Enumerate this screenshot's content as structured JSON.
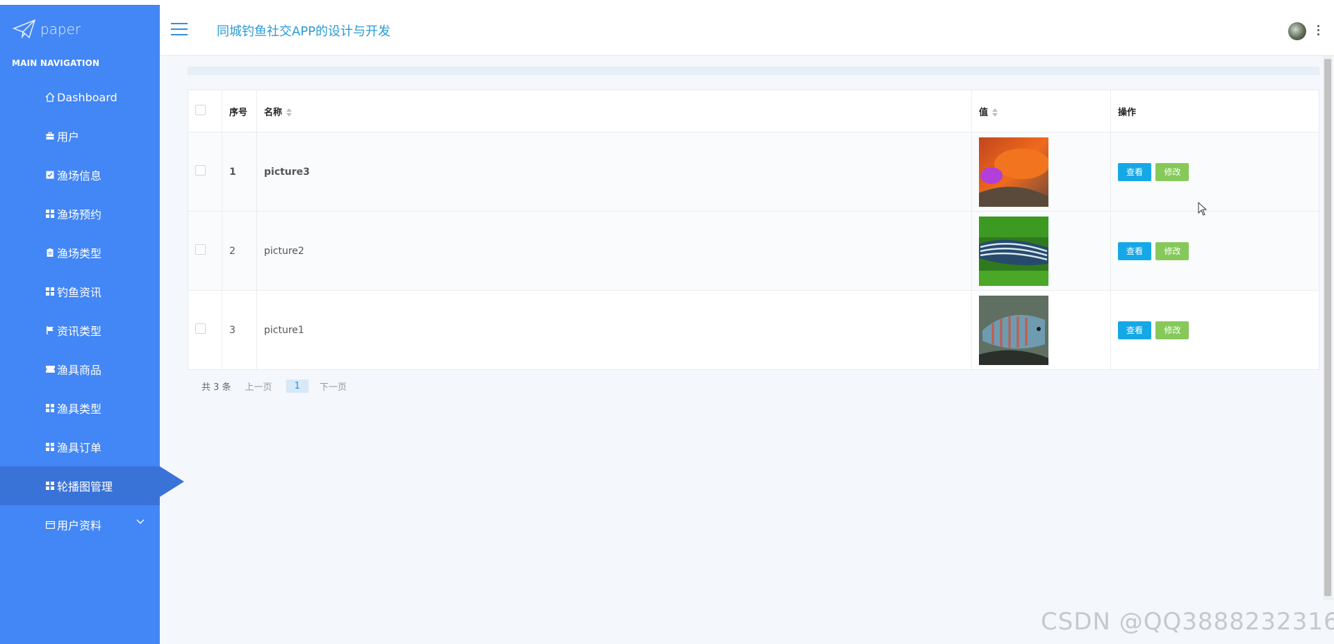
{
  "brand": {
    "name": "paper"
  },
  "sidebar": {
    "header": "MAIN NAVIGATION",
    "items": [
      {
        "label": "Dashboard",
        "icon": "home-icon"
      },
      {
        "label": "用户",
        "icon": "briefcase-icon"
      },
      {
        "label": "渔场信息",
        "icon": "check-square-icon"
      },
      {
        "label": "渔场预约",
        "icon": "grid-icon"
      },
      {
        "label": "渔场类型",
        "icon": "clipboard-icon"
      },
      {
        "label": "钓鱼资讯",
        "icon": "grid-icon"
      },
      {
        "label": "资讯类型",
        "icon": "flag-icon"
      },
      {
        "label": "渔具商品",
        "icon": "ticket-icon"
      },
      {
        "label": "渔具类型",
        "icon": "grid-icon"
      },
      {
        "label": "渔具订单",
        "icon": "grid-icon"
      },
      {
        "label": "轮播图管理",
        "icon": "grid-icon",
        "active": true
      },
      {
        "label": "用户资料",
        "icon": "card-icon",
        "expandable": true
      }
    ]
  },
  "header": {
    "title": "同城钓鱼社交APP的设计与开发"
  },
  "table": {
    "columns": [
      "序号",
      "名称",
      "值",
      "操作"
    ],
    "rows": [
      {
        "index": "1",
        "name": "picture3",
        "image": "orange-fish"
      },
      {
        "index": "2",
        "name": "picture2",
        "image": "striped-fish"
      },
      {
        "index": "3",
        "name": "picture1",
        "image": "blue-fish"
      }
    ],
    "actions": {
      "view": "查看",
      "edit": "修改"
    }
  },
  "pager": {
    "total": "共 3 条",
    "prev": "上一页",
    "current": "1",
    "next": "下一页"
  },
  "watermark": "CSDN @QQ3888232316",
  "colors": {
    "sidebar": "#4386f5",
    "sidebar_active": "#3a73d8",
    "view_button": "#16a8e6",
    "edit_button": "#86c95a",
    "title": "#2b9bd6"
  }
}
